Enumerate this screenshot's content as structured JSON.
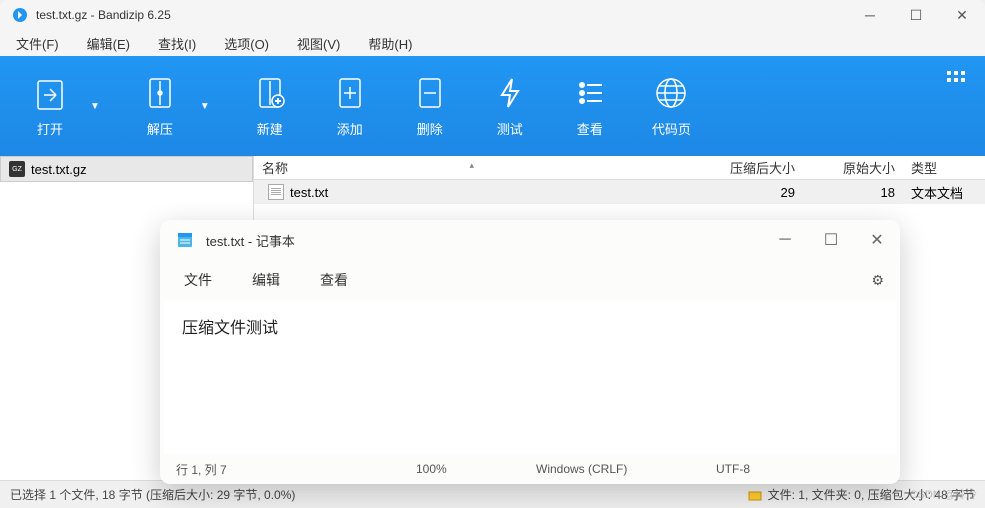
{
  "mainWindow": {
    "title": "test.txt.gz - Bandizip 6.25",
    "menu": {
      "file": "文件(F)",
      "edit": "编辑(E)",
      "find": "查找(I)",
      "options": "选项(O)",
      "view": "视图(V)",
      "help": "帮助(H)"
    },
    "toolbar": {
      "open": "打开",
      "extract": "解压",
      "new": "新建",
      "add": "添加",
      "delete": "删除",
      "test": "测试",
      "view": "查看",
      "codepage": "代码页"
    },
    "sidebar": {
      "archive": "test.txt.gz"
    },
    "listHeader": {
      "name": "名称",
      "compressedSize": "压缩后大小",
      "originalSize": "原始大小",
      "type": "类型"
    },
    "files": [
      {
        "name": "test.txt",
        "compressed": "29",
        "original": "18",
        "type": "文本文档"
      }
    ],
    "status": {
      "left": "已选择 1 个文件, 18 字节 (压缩后大小: 29 字节, 0.0%)",
      "right": "文件: 1, 文件夹: 0, 压缩包大小: 48 字节"
    }
  },
  "notepad": {
    "title": "test.txt - 记事本",
    "menu": {
      "file": "文件",
      "edit": "编辑",
      "view": "查看"
    },
    "content": "压缩文件测试",
    "status": {
      "pos": "行 1, 列 7",
      "zoom": "100%",
      "eol": "Windows (CRLF)",
      "encoding": "UTF-8"
    }
  },
  "watermark": "CSDN @冷冷"
}
